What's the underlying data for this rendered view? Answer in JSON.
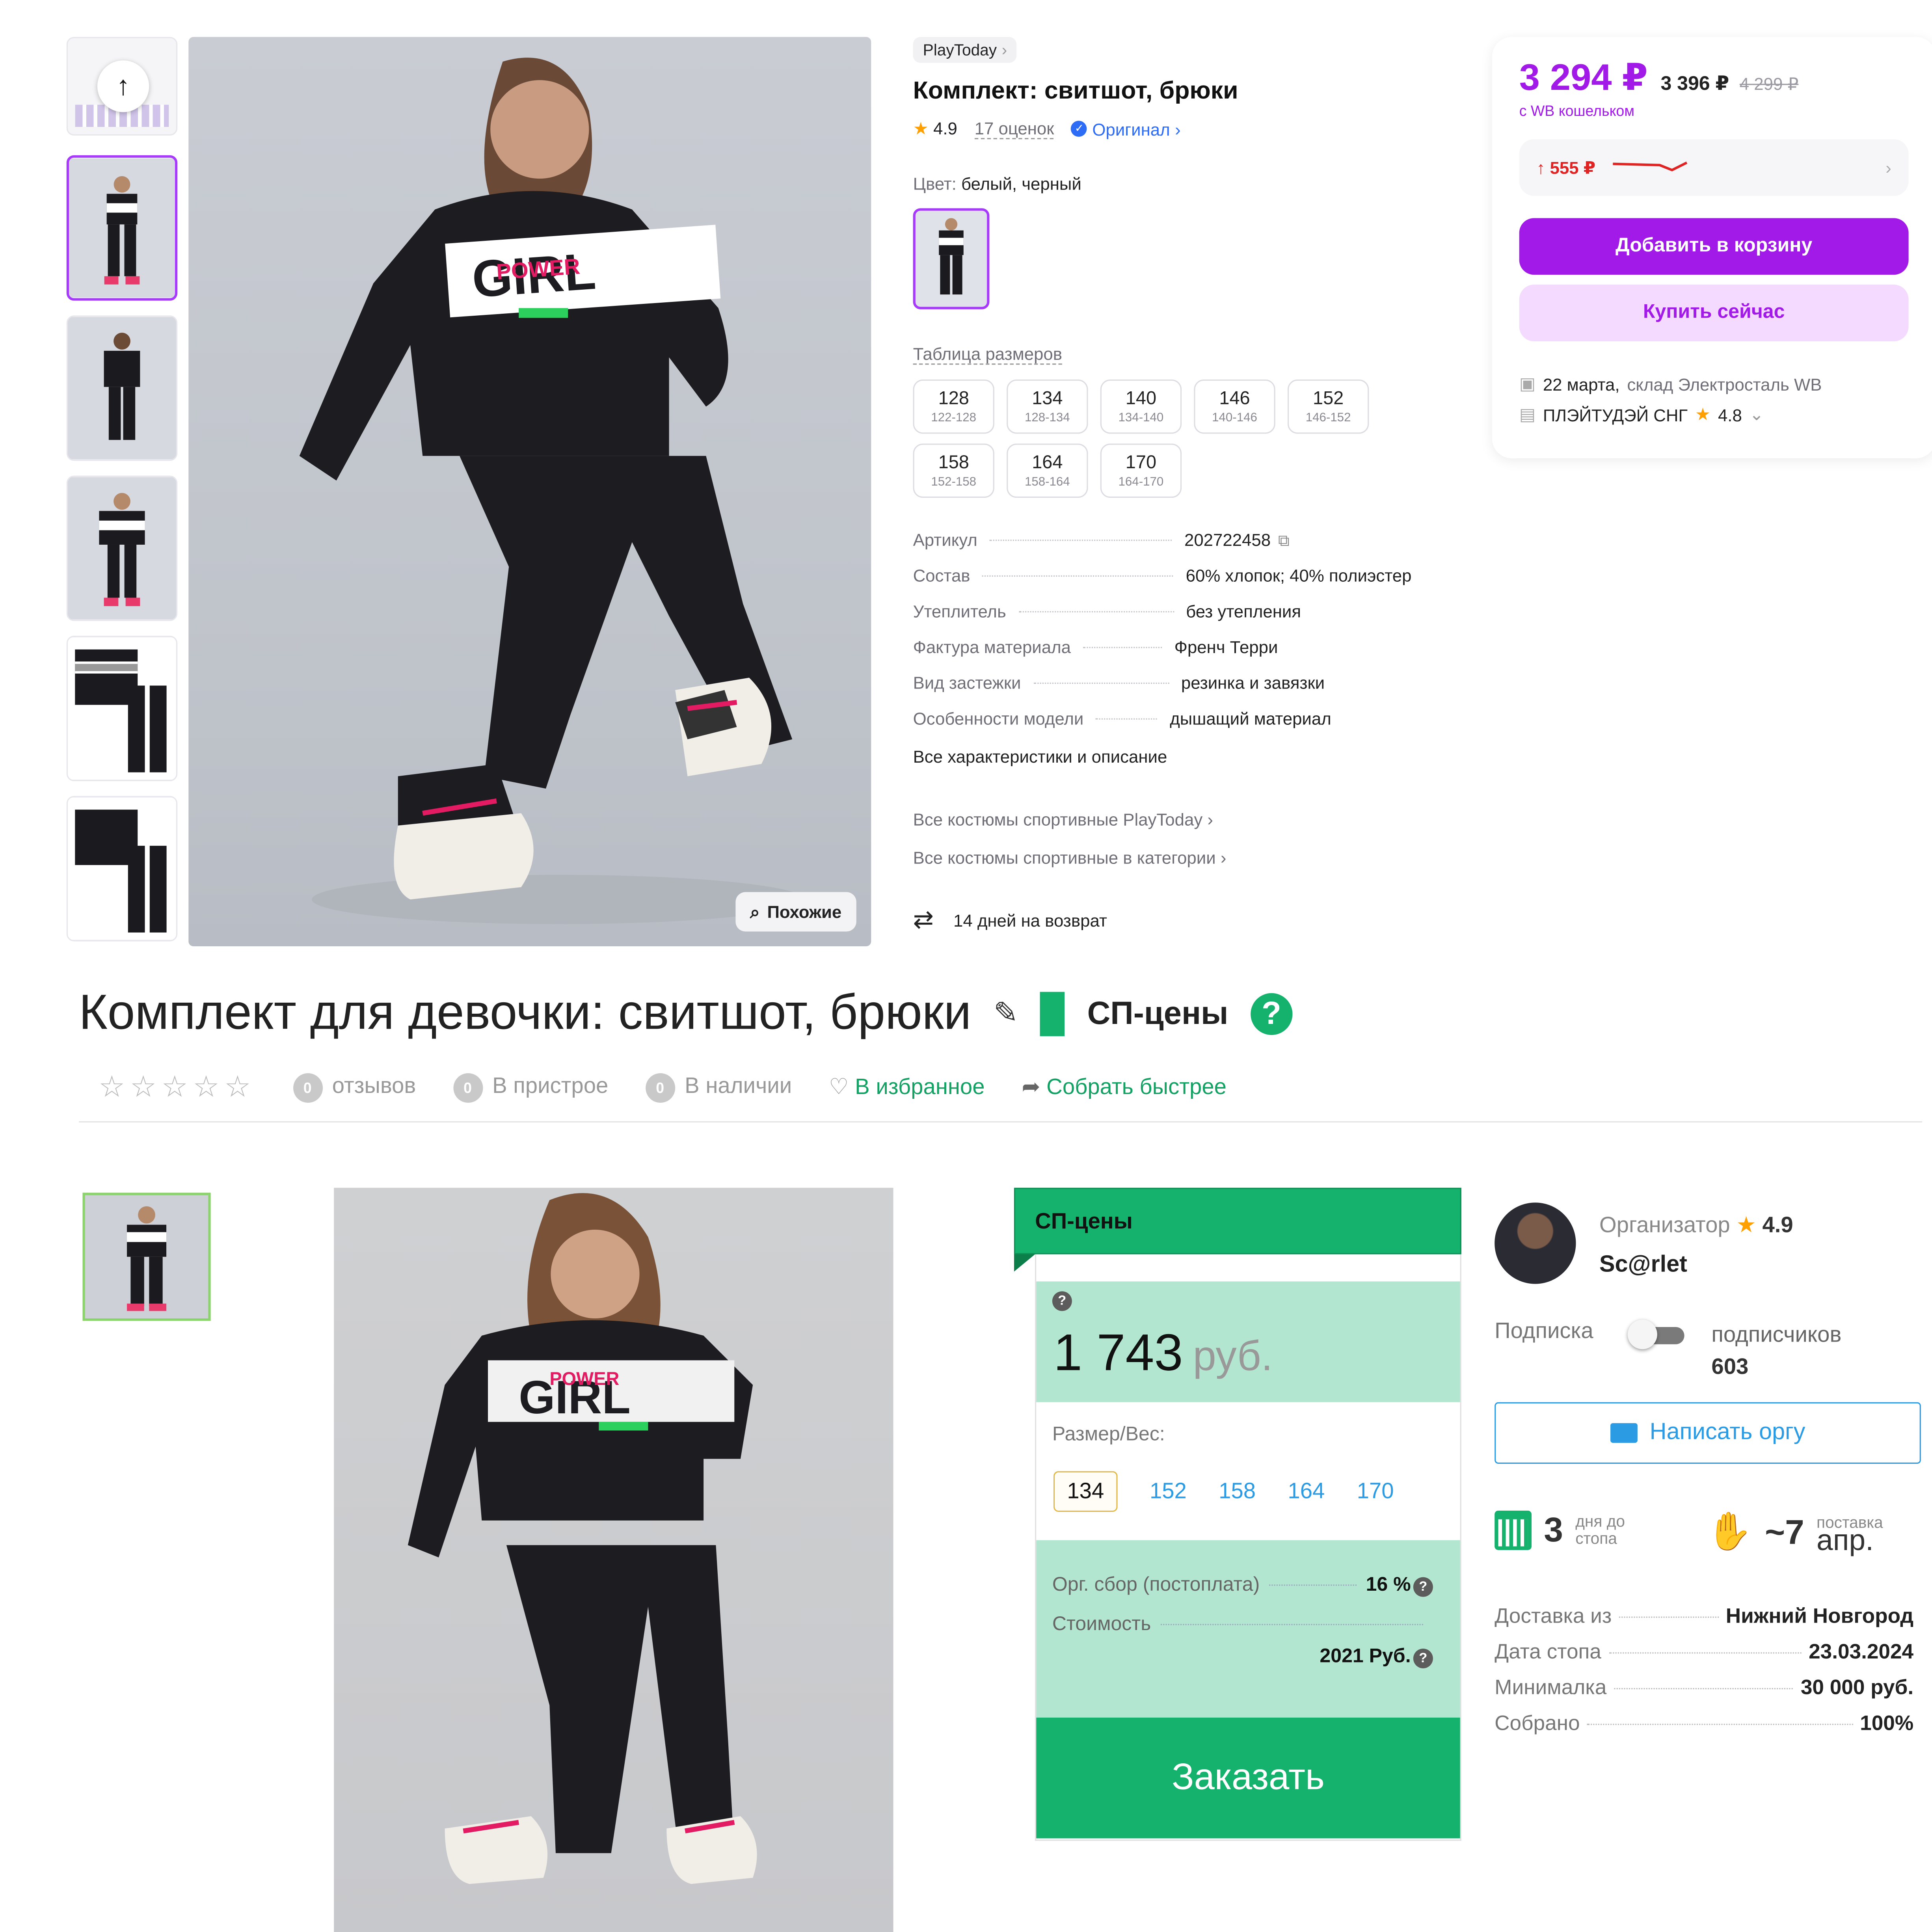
{
  "wb": {
    "brand": "PlayToday",
    "title": "Комплект: свитшот, брюки",
    "rating": "4.9",
    "reviews": "17 оценок",
    "original": "Оригинал",
    "color_label": "Цвет:",
    "color_value": "белый, черный",
    "size_table": "Таблица размеров",
    "sizes": [
      {
        "size": "128",
        "range": "122-128"
      },
      {
        "size": "134",
        "range": "128-134"
      },
      {
        "size": "140",
        "range": "134-140"
      },
      {
        "size": "146",
        "range": "140-146"
      },
      {
        "size": "152",
        "range": "146-152"
      },
      {
        "size": "158",
        "range": "152-158"
      },
      {
        "size": "164",
        "range": "158-164"
      },
      {
        "size": "170",
        "range": "164-170"
      }
    ],
    "specs": [
      {
        "key": "Артикул",
        "value": "202722458"
      },
      {
        "key": "Состав",
        "value": "60% хлопок; 40% полиэстер"
      },
      {
        "key": "Утеплитель",
        "value": "без утепления"
      },
      {
        "key": "Фактура материала",
        "value": "Френч Терри"
      },
      {
        "key": "Вид застежки",
        "value": "резинка и завязки"
      },
      {
        "key": "Особенности модели",
        "value": "дышащий материал"
      }
    ],
    "all_specs": "Все характеристики и описание",
    "link1": "Все костюмы спортивные PlayToday",
    "link2": "Все костюмы спортивные в категории",
    "return": "14 дней на возврат",
    "similar": "Похожие",
    "price": "3 294 ₽",
    "price_old": "3 396 ₽",
    "price_cross": "4 299 ₽",
    "wallet": "с WB кошельком",
    "history": "↑ 555 ₽",
    "add_to_cart": "Добавить в корзину",
    "buy_now": "Купить сейчас",
    "delivery_date": "22 марта,",
    "delivery_place": "склад Электросталь WB",
    "seller": "ПЛЭЙТУДЭЙ СНГ",
    "seller_rating": "4.8",
    "colors": {
      "accent": "#a11ae8",
      "selected_border": "#a73afd"
    }
  },
  "sp": {
    "title": "Комплект для девочки: свитшот, брюки",
    "sp_prices": "СП-цены",
    "reviews_count": "0",
    "reviews": "отзывов",
    "attach_count": "0",
    "attach": "В пристрое",
    "stock_count": "0",
    "stock": "В наличии",
    "favorite": "В избранное",
    "faster": "Собрать быстрее",
    "card_header": "СП-цены",
    "price": "1 743",
    "currency": "руб.",
    "size_label": "Размер/Вес:",
    "sizes": [
      "134",
      "152",
      "158",
      "164",
      "170"
    ],
    "fee_label": "Орг. сбор (постоплата)",
    "fee_value": "16 %",
    "cost_label": "Стоимость",
    "cost_value": "2021 Руб.",
    "order": "Заказать",
    "organizer_label": "Организатор",
    "organizer_rating": "4.9",
    "organizer_name": "Sc@rlet",
    "subscription": "Подписка",
    "subscribers_label": "подписчиков",
    "subscribers": "603",
    "write_org": "Написать оргу",
    "days_to_stop": "3",
    "days_to_stop_label_1": "дня до",
    "days_to_stop_label_2": "стопа",
    "supply_num": "~7",
    "supply_label": "поставка",
    "supply_month": "апр.",
    "stats": [
      {
        "key": "Доставка из",
        "value": "Нижний Новгород"
      },
      {
        "key": "Дата стопа",
        "value": "23.03.2024"
      },
      {
        "key": "Минималка",
        "value": "30 000 руб."
      },
      {
        "key": "Собрано",
        "value": "100%"
      }
    ],
    "colors": {
      "green": "#14b26c",
      "mint": "#b3e6d1",
      "link": "#2b9be4"
    }
  }
}
